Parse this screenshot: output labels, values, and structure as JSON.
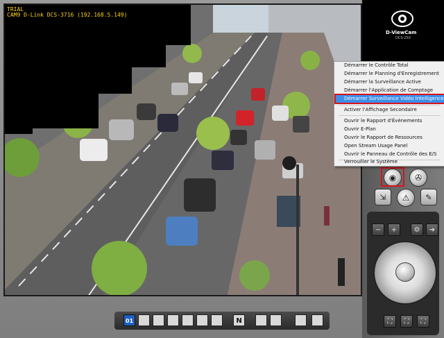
{
  "camera": {
    "trial_label": "TRIAL",
    "camera_title": "CAM9 D-Link DCS-3716 (192.168.5.149)"
  },
  "logo": {
    "brand": "D-ViewCam",
    "sub": "DCS-250"
  },
  "context_menu": {
    "items": [
      {
        "label": "Démarrer le Contrôle Total"
      },
      {
        "label": "Démarrer le Planning d'Enregistrement"
      },
      {
        "label": "Démarrer la Surveillance Active"
      },
      {
        "label": "Démarrer l'Application de Comptage"
      },
      {
        "label": "Démarrer Surveillance Vidéo Intelligence Avancée"
      },
      {
        "label": "Activer l'Affichage Secondaire"
      },
      {
        "label": "Ouvrir le Rapport d'Évènements"
      },
      {
        "label": "Ouvrir E-Plan"
      },
      {
        "label": "Ouvrir le Rapport de Ressources"
      },
      {
        "label": "Open Stream Usage Panel"
      },
      {
        "label": "Ouvrir le Panneau de Contrôle des E/S"
      },
      {
        "label": "Verrouiller le Système"
      }
    ],
    "highlighted_index": 4
  },
  "layout_bar": {
    "current_layout": "01",
    "n_label": "N"
  },
  "colors": {
    "highlight": "#3d8ee8",
    "red_outline": "#d9141b",
    "osd_text": "#ffd21a"
  },
  "icons": {
    "main_button": "camera-eye-icon",
    "ptz_button": "film-reel-icon",
    "export_button": "export-icon",
    "alert_button": "warning-icon",
    "tools_button": "wrench-icon",
    "zoom_out": "minus-icon",
    "zoom_in": "plus-icon",
    "focus": "focus-icon",
    "iris": "arrow-right-icon",
    "joystick": "joystick-icon",
    "preset_1": "preset-icon",
    "preset_2": "preset-icon",
    "preset_3": "preset-icon"
  }
}
